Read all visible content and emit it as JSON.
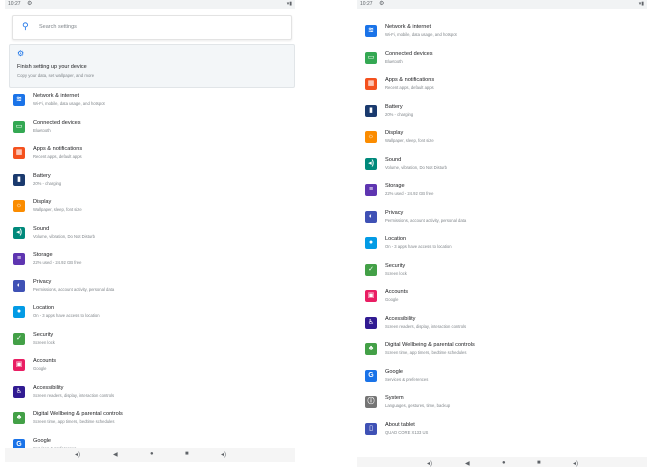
{
  "statusbar": {
    "time": "10:27",
    "gear": "⚙",
    "signal": "▾▮"
  },
  "search": {
    "icon": "search-icon",
    "placeholder": "Search settings"
  },
  "suggestion": {
    "title": "Finish setting up your device",
    "subtitle": "Copy your data, set wallpaper, and more"
  },
  "items": [
    {
      "key": "network",
      "title": "Network & internet",
      "subtitle": "Wi-Fi, mobile, data usage, and hotspot",
      "color": "#1a73e8",
      "glyph": "≋"
    },
    {
      "key": "connected",
      "title": "Connected devices",
      "subtitle": "Bluetooth",
      "color": "#34a853",
      "glyph": "▭"
    },
    {
      "key": "apps",
      "title": "Apps & notifications",
      "subtitle": "Recent apps, default apps",
      "color": "#f4511e",
      "glyph": "▦"
    },
    {
      "key": "battery",
      "title": "Battery",
      "subtitle": "20% - charging",
      "color": "#1a3a6e",
      "glyph": "▮"
    },
    {
      "key": "display",
      "title": "Display",
      "subtitle": "Wallpaper, sleep, font size",
      "color": "#fb8c00",
      "glyph": "☼"
    },
    {
      "key": "sound",
      "title": "Sound",
      "subtitle": "Volume, vibration, Do Not Disturb",
      "color": "#00897b",
      "glyph": "◂)"
    },
    {
      "key": "storage",
      "title": "Storage",
      "subtitle": "22% used - 24.92 GB free",
      "color": "#5e35b1",
      "glyph": "≡"
    },
    {
      "key": "privacy",
      "title": "Privacy",
      "subtitle": "Permissions, account activity, personal data",
      "color": "#3f51b5",
      "glyph": "◐"
    },
    {
      "key": "location",
      "title": "Location",
      "subtitle": "On - 3 apps have access to location",
      "color": "#039be5",
      "glyph": "●"
    },
    {
      "key": "security",
      "title": "Security",
      "subtitle": "Screen lock",
      "color": "#43a047",
      "glyph": "✓"
    },
    {
      "key": "accounts",
      "title": "Accounts",
      "subtitle": "Google",
      "color": "#e91e63",
      "glyph": "▣"
    },
    {
      "key": "accessibility",
      "title": "Accessibility",
      "subtitle": "Screen readers, display, interaction controls",
      "color": "#311b92",
      "glyph": "♿"
    },
    {
      "key": "wellbeing",
      "title": "Digital Wellbeing & parental controls",
      "subtitle": "Screen time, app timers, bedtime schedules",
      "color": "#43a047",
      "glyph": "♣"
    },
    {
      "key": "google",
      "title": "Google",
      "subtitle": "Services & preferences",
      "color": "#1a73e8",
      "glyph": "G"
    },
    {
      "key": "system",
      "title": "System",
      "subtitle": "Languages, gestures, time, backup",
      "color": "#757575",
      "glyph": "ⓘ"
    },
    {
      "key": "about",
      "title": "About tablet",
      "subtitle": "QUAD CORE X133 US",
      "color": "#3f51b5",
      "glyph": "▯"
    }
  ],
  "navbar": {
    "icons": [
      "◂)",
      "◀",
      "●",
      "■",
      "◂)"
    ]
  }
}
